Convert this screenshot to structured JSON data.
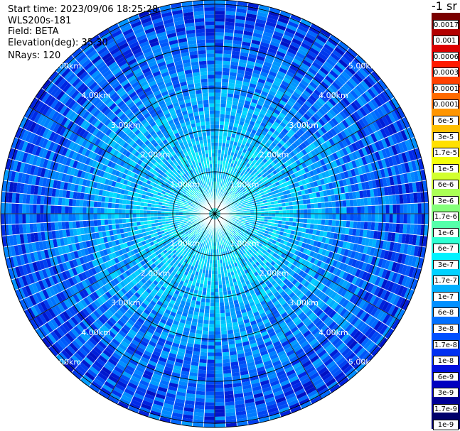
{
  "header": {
    "start_time": "Start time: 2023/09/06 18:25:28",
    "device": "WLS200s-181",
    "field": "Field: BETA",
    "elevation": "Elevation(deg): 35.30",
    "nrays": "NRays: 120"
  },
  "colorbar": {
    "unit_label": "-1 sr",
    "levels": [
      "0.0017",
      "0.001",
      "0.0006",
      "0.0003",
      "0.00017",
      "0.0001",
      "6e-5",
      "3e-5",
      "1.7e-5",
      "1e-5",
      "6e-6",
      "3e-6",
      "1.7e-6",
      "1e-6",
      "6e-7",
      "3e-7",
      "1.7e-7",
      "1e-7",
      "6e-8",
      "3e-8",
      "1.7e-8",
      "1e-8",
      "6e-9",
      "3e-9",
      "1.7e-9",
      "1e-9"
    ],
    "colors": [
      "#7a0000",
      "#b30000",
      "#dd0000",
      "#ff1a00",
      "#ff4000",
      "#ff6a00",
      "#ff9500",
      "#ffbf00",
      "#ffe000",
      "#f4ff0a",
      "#d2ff2e",
      "#aaff55",
      "#85ff7a",
      "#55ffaa",
      "#2effd2",
      "#00f2ff",
      "#00d2ff",
      "#00b0ff",
      "#0090ff",
      "#0070ff",
      "#0050ff",
      "#0030f0",
      "#0010dd",
      "#0000c0",
      "#000095",
      "#00006a"
    ]
  },
  "chart_data": {
    "type": "heatmap",
    "subtype": "lidar PPI scan (polar)",
    "field": "BETA",
    "elevation_deg": 35.3,
    "nrays": 120,
    "range_ring_labels": [
      "1.00km",
      "2.00km",
      "3.00km",
      "4.00km",
      "5.00km"
    ],
    "range_rings_km": [
      1,
      2,
      3,
      4,
      5
    ],
    "max_range_km": 5.1,
    "radial_lines_every_deg": 30,
    "value_range_log10": [
      -9,
      -2.77
    ],
    "dominant_colors": [
      "cyan near center",
      "light blue mid range",
      "blue at outer ranges"
    ]
  }
}
